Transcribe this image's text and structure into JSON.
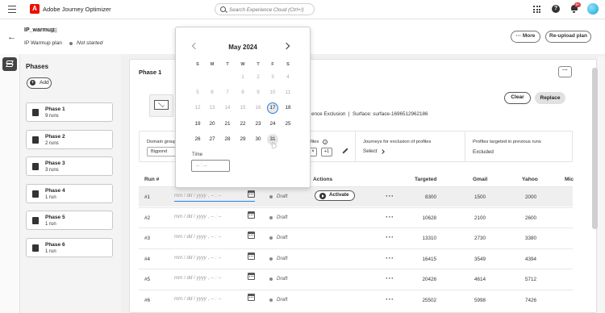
{
  "app": {
    "name": "Adobe Journey Optimizer",
    "search_placeholder": "Search Experience Cloud (Ctrl+/)",
    "notif_count": "9+"
  },
  "header": {
    "plan_name": "IP_warmup",
    "plan_type": "IP Warmup plan",
    "status": "Not started",
    "more_label": "More",
    "reupload_label": "Re-upload plan"
  },
  "phases": {
    "title": "Phases",
    "add_label": "Add",
    "items": [
      {
        "label": "Phase 1",
        "runs": "9 runs"
      },
      {
        "label": "Phase 2",
        "runs": "2 runs"
      },
      {
        "label": "Phase 3",
        "runs": "3 runs"
      },
      {
        "label": "Phase 4",
        "runs": "1 run"
      },
      {
        "label": "Phase 5",
        "runs": "1 run"
      },
      {
        "label": "Phase 6",
        "runs": "1 run"
      }
    ]
  },
  "phase_detail": {
    "title": "Phase 1",
    "exclusion_text": "ence Exclusion",
    "surface_text": "Surface: surface-1696512962186",
    "clear_label": "Clear",
    "replace_label": "Replace",
    "domain_group_label": "Domain group",
    "domain_group_value": "Bigpond",
    "profiles_label": "files",
    "plus_one": "+1",
    "journeys_label": "Journeys for exclusion of profiles",
    "select_label": "Select",
    "prev_runs_label": "Profiles targeted in previous runs",
    "prev_runs_value": "Excluded"
  },
  "table": {
    "headers": {
      "run": "Run #",
      "actions": "Actions",
      "targeted": "Targeted",
      "gmail": "Gmail",
      "yahoo": "Yahoo",
      "mic": "Mic"
    },
    "date_placeholder": "mm / dd / yyyy ,  -- : --",
    "activate_label": "Activate",
    "rows": [
      {
        "run": "#1",
        "status": "Draft",
        "targeted": "8300",
        "gmail": "1500",
        "yahoo": "2000"
      },
      {
        "run": "#2",
        "status": "Draft",
        "targeted": "10628",
        "gmail": "2100",
        "yahoo": "2600"
      },
      {
        "run": "#3",
        "status": "Draft",
        "targeted": "13310",
        "gmail": "2730",
        "yahoo": "3380"
      },
      {
        "run": "#4",
        "status": "Draft",
        "targeted": "16415",
        "gmail": "3549",
        "yahoo": "4394"
      },
      {
        "run": "#5",
        "status": "Draft",
        "targeted": "20426",
        "gmail": "4614",
        "yahoo": "5712"
      },
      {
        "run": "#6",
        "status": "Draft",
        "targeted": "25502",
        "gmail": "5998",
        "yahoo": "7426"
      }
    ]
  },
  "calendar": {
    "month": "May 2024",
    "weekdays": [
      "S",
      "M",
      "T",
      "W",
      "T",
      "F",
      "S"
    ],
    "weeks": [
      [
        "",
        "",
        "",
        "1",
        "2",
        "3",
        "4"
      ],
      [
        "5",
        "6",
        "7",
        "8",
        "9",
        "10",
        "11"
      ],
      [
        "12",
        "13",
        "14",
        "15",
        "16",
        "17",
        "18"
      ],
      [
        "19",
        "20",
        "21",
        "22",
        "23",
        "24",
        "25"
      ],
      [
        "26",
        "27",
        "28",
        "29",
        "30",
        "31",
        ""
      ]
    ],
    "today": "17",
    "hovered": "31",
    "enabled_from": 17,
    "time_label": "Time",
    "time_placeholder": "-- : --"
  },
  "colors": {
    "accent": "#2680eb",
    "adobe_red": "#eb1000"
  }
}
